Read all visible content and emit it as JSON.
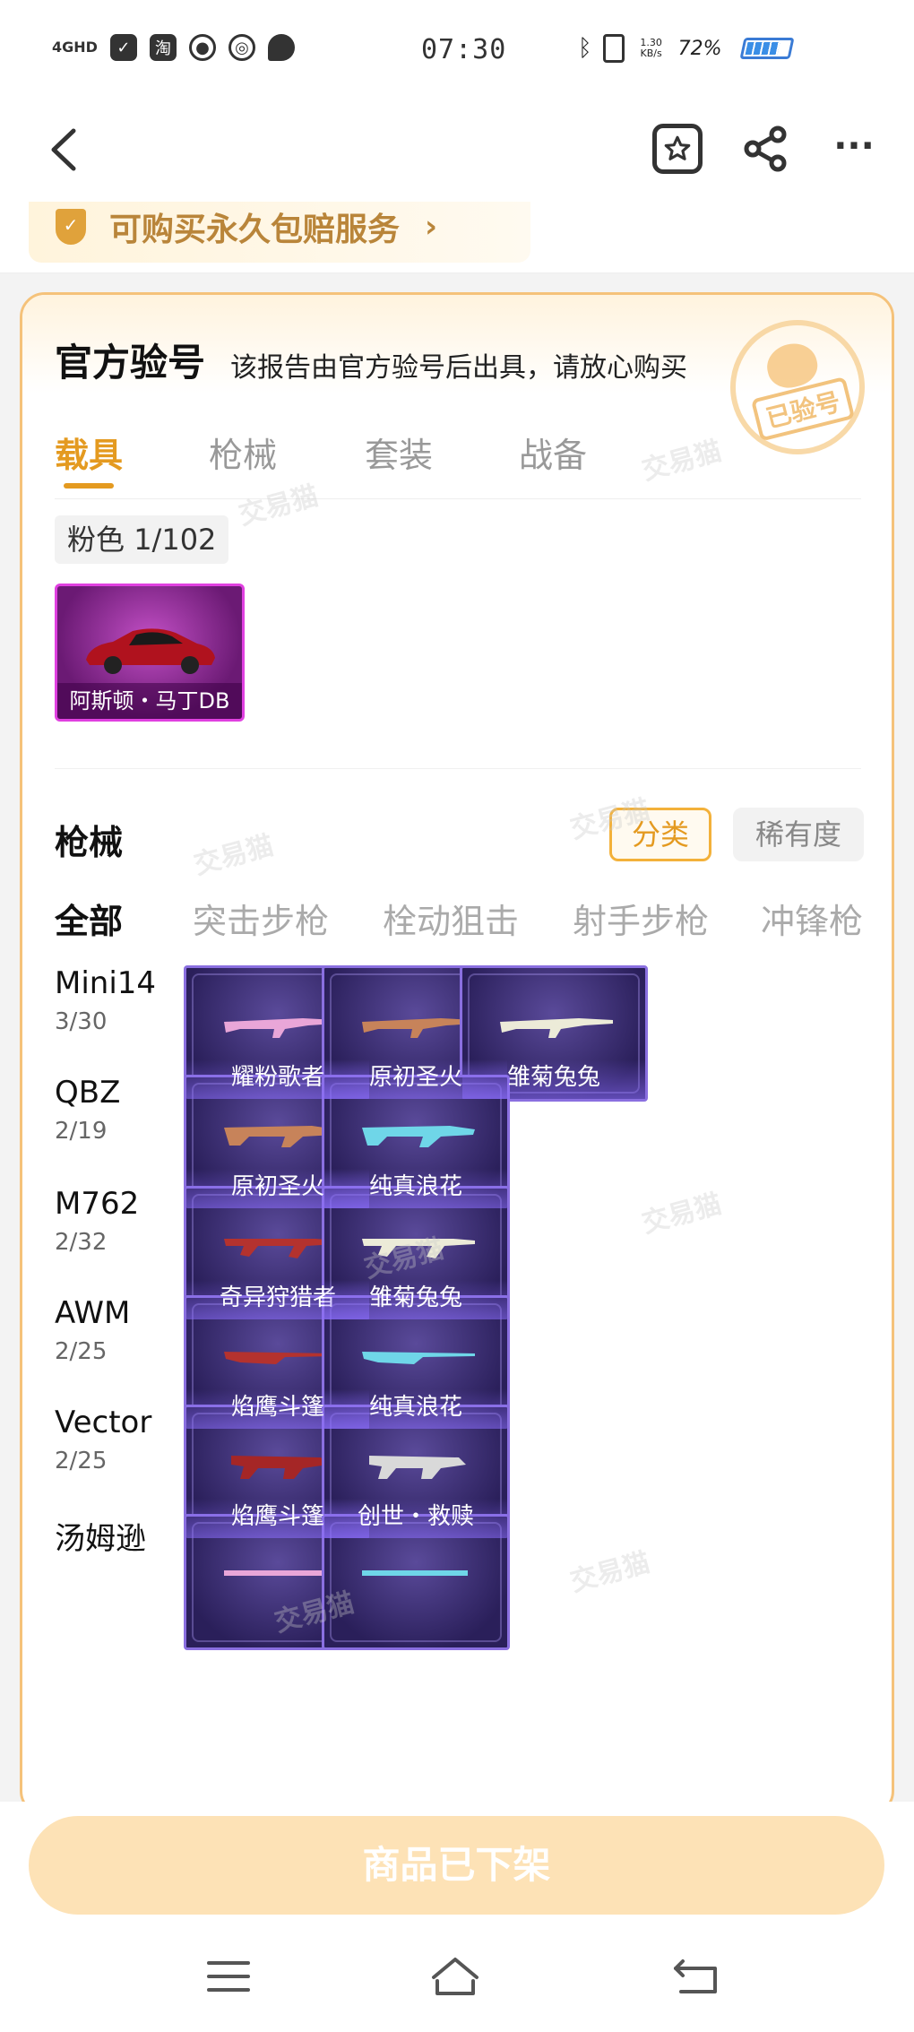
{
  "status_bar": {
    "network": "4GHD",
    "time": "07:30",
    "speed": "1.30 KB/s",
    "battery_pct": "72%"
  },
  "nav": {
    "back_icon": "chevron-left-icon",
    "fav_icon": "star-bookmark-icon",
    "share_icon": "share-icon",
    "more_icon": "more-dots-icon"
  },
  "guarantee": {
    "text": "可购买永久包赔服务",
    "arrow": "›"
  },
  "report": {
    "title": "官方验号",
    "subtitle": "该报告由官方验号后出具，请放心购买",
    "stamp": "已验号",
    "tabs": [
      "载具",
      "枪械",
      "套装",
      "战备"
    ],
    "active_tab": 0
  },
  "vehicles": {
    "tag_label": "粉色",
    "tag_count": "1/102",
    "items": [
      {
        "name": "阿斯顿・马丁DB"
      }
    ]
  },
  "guns": {
    "section_title": "枪械",
    "sort_active": "分类",
    "sort_inactive": "稀有度",
    "filters": [
      "全部",
      "突击步枪",
      "栓动狙击",
      "射手步枪",
      "冲锋枪"
    ],
    "rows": [
      {
        "name": "Mini14",
        "count": "3/30",
        "skins": [
          "耀粉歌者",
          "原初圣火",
          "雏菊兔兔"
        ]
      },
      {
        "name": "QBZ",
        "count": "2/19",
        "skins": [
          "原初圣火",
          "纯真浪花"
        ]
      },
      {
        "name": "M762",
        "count": "2/32",
        "skins": [
          "奇异狩猎者",
          "雏菊兔兔"
        ]
      },
      {
        "name": "AWM",
        "count": "2/25",
        "skins": [
          "焰鹰斗篷",
          "纯真浪花"
        ]
      },
      {
        "name": "Vector",
        "count": "2/25",
        "skins": [
          "焰鹰斗篷",
          "创世・救赎"
        ]
      },
      {
        "name": "汤姆逊",
        "count": "",
        "skins": [
          "",
          ""
        ]
      }
    ]
  },
  "watermark_text": "交易猫",
  "bottom": {
    "button_label": "商品已下架"
  },
  "colors": {
    "accent": "#e49a20",
    "card_border": "#f5c27a",
    "button_bg": "#fde2b6",
    "skin_tile": "#2a1f5a"
  }
}
